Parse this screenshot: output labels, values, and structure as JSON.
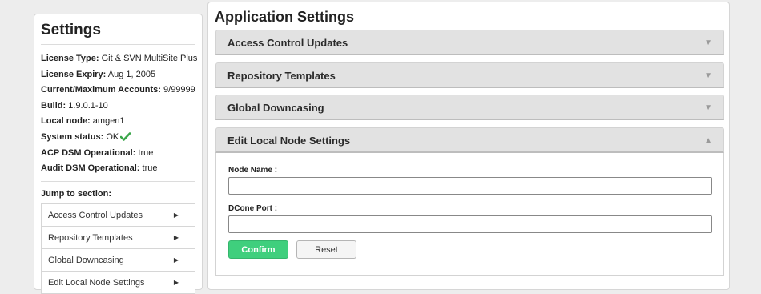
{
  "sidebar": {
    "title": "Settings",
    "info": [
      {
        "key": "License Type:",
        "value": "Git & SVN MultiSite Plus"
      },
      {
        "key": "License Expiry:",
        "value": "Aug 1, 2005"
      },
      {
        "key": "Current/Maximum Accounts:",
        "value": "9/99999"
      },
      {
        "key": "Build:",
        "value": "1.9.0.1-10"
      },
      {
        "key": "Local node:",
        "value": "amgen1"
      },
      {
        "key": "System status:",
        "value": "OK"
      },
      {
        "key": "ACP DSM Operational:",
        "value": "true"
      },
      {
        "key": "Audit DSM Operational:",
        "value": "true"
      }
    ],
    "status_icon": "check-icon",
    "status_color": "#3aa64a",
    "jump_label": "Jump to section:",
    "jump_items": [
      {
        "label": "Access Control Updates",
        "icon": "triangle-right-icon"
      },
      {
        "label": "Repository Templates",
        "icon": "triangle-right-icon"
      },
      {
        "label": "Global Downcasing",
        "icon": "triangle-right-icon"
      },
      {
        "label": "Edit Local Node Settings",
        "icon": "triangle-right-icon"
      }
    ]
  },
  "main": {
    "title": "Application Settings",
    "sections": [
      {
        "label": "Access Control Updates",
        "expanded": false
      },
      {
        "label": "Repository Templates",
        "expanded": false
      },
      {
        "label": "Global Downcasing",
        "expanded": false
      },
      {
        "label": "Edit Local Node Settings",
        "expanded": true
      }
    ],
    "form": {
      "node_name_label": "Node Name :",
      "node_name_value": "",
      "dcone_port_label": "DCone Port :",
      "dcone_port_value": "",
      "confirm_label": "Confirm",
      "reset_label": "Reset"
    },
    "colors": {
      "confirm": "#3fcf7d",
      "header_bg": "#e2e2e2"
    }
  }
}
